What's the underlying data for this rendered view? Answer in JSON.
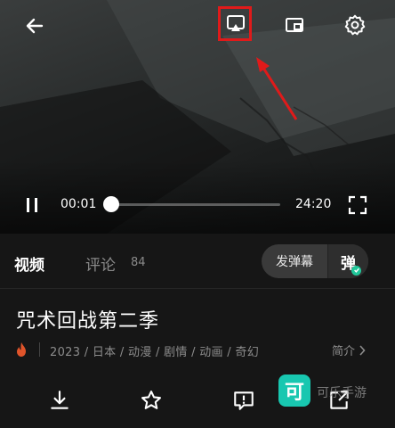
{
  "player": {
    "current_time": "00:01",
    "total_time": "24:20",
    "progress": 0.01
  },
  "annotation": {
    "highlight_color": "#e01a1a",
    "arrow_color": "#e01a1a"
  },
  "tabs": {
    "video_label": "视频",
    "comments_label": "评论",
    "comments_count": "84",
    "danmaku_send_label": "发弹幕",
    "danmaku_toggle_label": "弹"
  },
  "show": {
    "title": "咒术回战第二季",
    "meta": "2023 / 日本 / 动漫 / 剧情 / 动画 / 奇幻",
    "intro_label": "简介"
  },
  "actions": [
    "download-icon",
    "star-icon",
    "report-icon",
    "share-icon"
  ],
  "watermark": {
    "badge_char": "可",
    "text": "可乐手游"
  },
  "colors": {
    "accent_teal": "#21c79a",
    "heat": "#e0542a",
    "background": "#161616"
  }
}
